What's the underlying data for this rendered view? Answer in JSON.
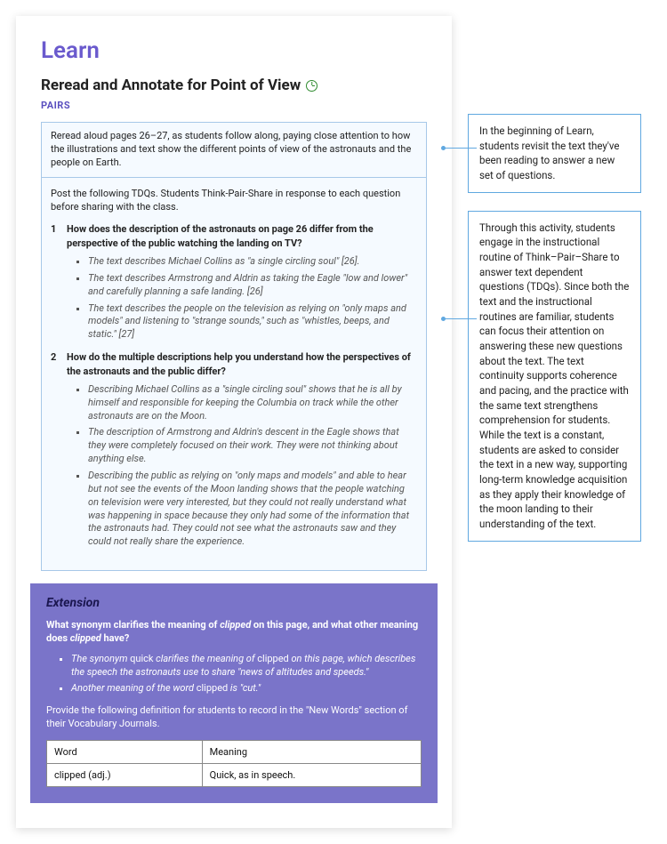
{
  "page": {
    "section_heading": "Learn",
    "lesson_title": "Reread and Annotate for Point of View",
    "mode_label": "PAIRS",
    "read_aloud": "Reread aloud pages 26–27, as students follow along, paying close attention to how the illustrations and text show the different points of view of the astronauts and the people on Earth.",
    "tdq_intro": "Post the following TDQs. Students Think-Pair-Share in response to each question before sharing with the class.",
    "questions": [
      {
        "prompt": "How does the description of the astronauts on page 26 differ from the perspective of the public watching the landing on TV?",
        "answers": [
          "The text describes Michael Collins as \"a single circling soul\" [26].",
          "The text describes Armstrong and Aldrin as taking the Eagle \"low and lower\" and carefully planning a safe landing. [26]",
          "The text describes the people on the television as relying on \"only maps and models\" and listening to \"strange sounds,\" such as \"whistles, beeps, and static.\" [27]"
        ]
      },
      {
        "prompt": "How do the multiple descriptions help you understand how the perspectives of the astronauts and the public differ?",
        "answers": [
          "Describing Michael Collins as a \"single circling soul\" shows that he is all by himself and responsible for keeping the Columbia on track while the other astronauts are on the Moon.",
          "The description of Armstrong and Aldrin's descent in the Eagle shows that they were completely focused on their work. They were not thinking about anything else.",
          "Describing the public as relying on \"only maps and models\" and able to hear but not see the events of the Moon landing shows that the people watching on television were very interested, but they could not really understand what was happening in space because they only had some of the information that the astronauts had. They could not see what the astronauts saw and they could not really share the experience."
        ]
      }
    ],
    "extension": {
      "title": "Extension",
      "question_parts": [
        "What synonym clarifies the meaning of ",
        "clipped",
        " on this page, and what other meaning does ",
        "clipped",
        " have?"
      ],
      "bullets_parts": [
        [
          "The synonym ",
          "quick",
          " clarifies the meaning of ",
          "clipped",
          " on this page, which describes the speech the astronauts use to share \"news of altitudes and speeds.\""
        ],
        [
          "Another meaning of the word ",
          "clipped",
          " is \"cut.\""
        ]
      ],
      "note": "Provide the following definition for students to record in the \"New Words\" section of their Vocabulary Journals.",
      "table": {
        "headers": [
          "Word",
          "Meaning"
        ],
        "rows": [
          [
            "clipped (adj.)",
            "Quick, as in speech."
          ]
        ]
      }
    }
  },
  "callouts": [
    "In the beginning of Learn, students revisit the text they've been reading to answer a new set of questions.",
    "Through this activity, students engage in the instructional routine of Think–Pair–Share to answer text dependent questions (TDQs). Since both the text and the instructional routines are familiar, students can focus their attention on answering these new questions about the text. The text continuity supports coherence and pacing, and the practice with the same text strengthens comprehension for students. While the text is a constant, students are asked to consider the text in a new way, supporting long-term knowledge acquisition as they apply their knowledge of the moon landing to their understanding of the text."
  ]
}
